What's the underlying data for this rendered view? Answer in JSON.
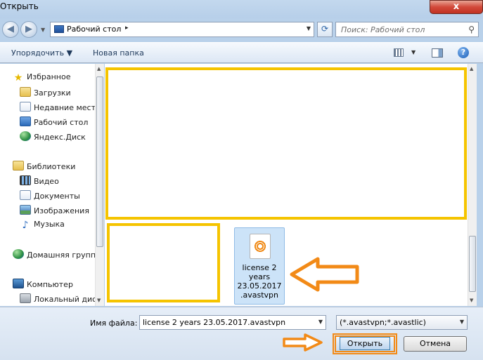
{
  "window": {
    "title": "Открыть",
    "close_label": "x"
  },
  "address": {
    "location": "Рабочий стол",
    "separator": "▸",
    "search_placeholder": "Поиск: Рабочий стол"
  },
  "toolbar": {
    "organize_label": "Упорядочить ▼",
    "new_folder_label": "Новая папка",
    "help_label": "?"
  },
  "sidebar": {
    "items": [
      {
        "label": "Избранное",
        "icon": "star-icon"
      },
      {
        "label": "Загрузки",
        "icon": "downloads-folder-icon"
      },
      {
        "label": "Недавние места",
        "icon": "recent-places-icon"
      },
      {
        "label": "Рабочий стол",
        "icon": "desktop-icon"
      },
      {
        "label": "Яндекс.Диск",
        "icon": "yandex-disk-icon"
      },
      {
        "label": "Библиотеки",
        "icon": "libraries-icon"
      },
      {
        "label": "Видео",
        "icon": "video-icon"
      },
      {
        "label": "Документы",
        "icon": "documents-icon"
      },
      {
        "label": "Изображения",
        "icon": "pictures-icon"
      },
      {
        "label": "Музыка",
        "icon": "music-icon"
      },
      {
        "label": "Домашняя группа",
        "icon": "homegroup-icon"
      },
      {
        "label": "Компьютер",
        "icon": "computer-icon"
      },
      {
        "label": "Локальный диск",
        "icon": "local-disk-icon"
      }
    ]
  },
  "files": {
    "selected_file": {
      "label": "license 2 years 23.05.2017.avastvpn",
      "icon": "avast-license-file-icon"
    }
  },
  "bottom": {
    "filename_label": "Имя файла:",
    "filename_value": "license 2 years 23.05.2017.avastvpn",
    "filetype_value": "(*.avastvpn;*.avastlic)",
    "open_label": "Открыть",
    "cancel_label": "Отмена"
  },
  "colors": {
    "highlight_yellow": "#f5c400",
    "highlight_orange": "#f28a17",
    "selection_blue": "#cce3f8"
  }
}
